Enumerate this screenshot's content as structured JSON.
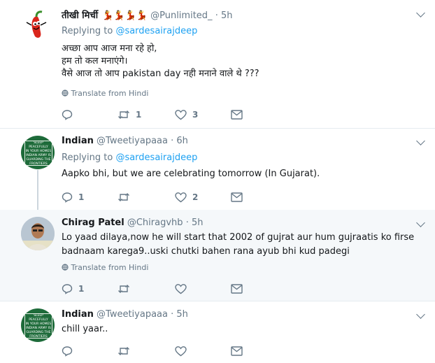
{
  "tweets": [
    {
      "name": "तीखी मिर्ची",
      "name_emojis": "💃💃💃💃",
      "handle": "@Punlimited_",
      "time": "· 5h",
      "reply_prefix": "Replying to",
      "reply_to": "@sardesairajdeep",
      "lines": [
        "अच्छा आप आज मना रहे हो,",
        "हम तो कल मनाएंगे।",
        "वैसे आज तो आप pakistan day नही मनाने वाले थे ???"
      ],
      "translate": "Translate from Hindi",
      "retweets": "1",
      "likes": "3"
    },
    {
      "name": "Indian",
      "handle": "@Tweetiyapaaa",
      "time": "· 6h",
      "reply_prefix": "Replying to",
      "reply_to": "@sardesairajdeep",
      "lines": [
        "Aapko bhi, but we are celebrating tomorrow (In Gujarat)."
      ],
      "replies": "1",
      "likes": "2"
    },
    {
      "name": "Chirag Patel",
      "handle": "@Chiragvhb",
      "time": "· 5h",
      "lines": [
        "Lo yaad dilaya,now he will start that 2002 of gujrat aur hum gujraatis ko firse",
        "badnaam karega9..uski chutki bahen rana ayub bhi kud padegi"
      ],
      "translate": "Translate from Hindi",
      "replies": "1"
    },
    {
      "name": "Indian",
      "handle": "@Tweetiyapaaa",
      "time": "· 5h",
      "lines": [
        "chill yaar.."
      ]
    }
  ],
  "avatar_sign_text": [
    "SLEEP PEACEFULLY",
    "IN YOUR HOMES",
    "INDIAN ARMY IS",
    "GUARDING THE FRONTIERS"
  ],
  "colors": {
    "link": "#1da1f2",
    "muted": "#657786",
    "highlight_bg": "#f5f8fa",
    "border": "#e6ecf0",
    "sign_green": "#1e6b3a"
  },
  "icons": [
    "chili-icon",
    "reply-icon",
    "retweet-icon",
    "like-icon",
    "dm-icon",
    "globe-icon",
    "caret-down-icon"
  ]
}
